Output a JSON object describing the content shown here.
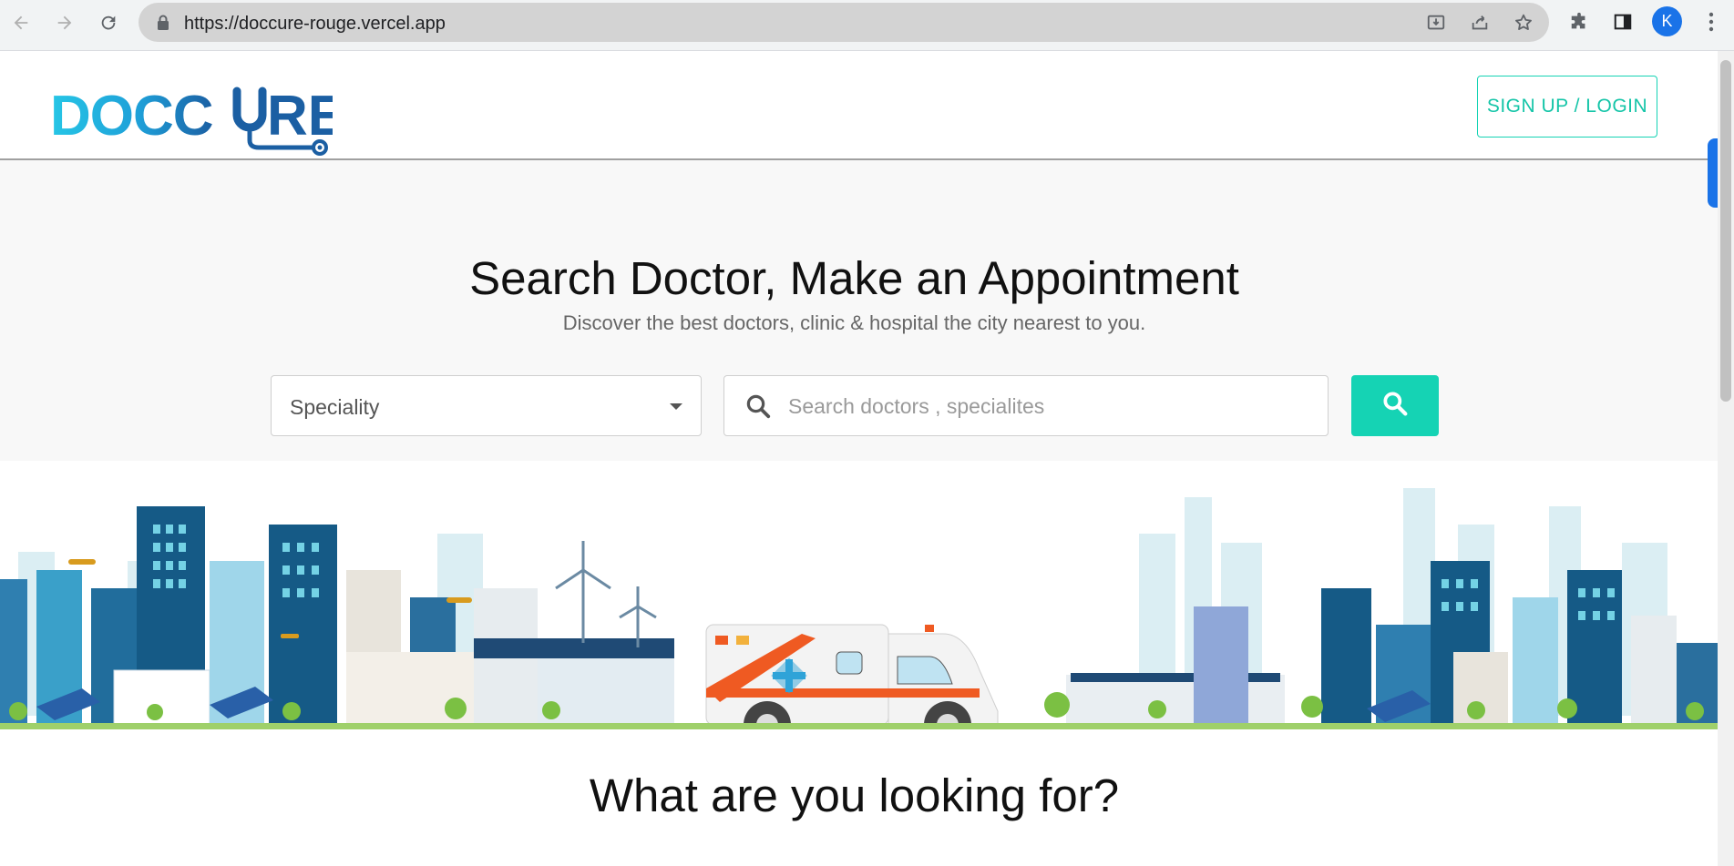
{
  "browser": {
    "url": "https://doccure-rouge.vercel.app",
    "profile_initial": "K",
    "icons": [
      "back-icon",
      "forward-icon",
      "reload-icon",
      "lock-icon",
      "install-icon",
      "share-icon",
      "star-icon",
      "extensions-icon",
      "side-panel-icon",
      "menu-icon"
    ]
  },
  "header": {
    "logo_text": "DOCCURE",
    "login_label": "SIGN UP / LOGIN"
  },
  "hero": {
    "title": "Search Doctor, Make an Appointment",
    "subtitle": "Discover the best doctors, clinic & hospital the city nearest to you.",
    "speciality_label": "Speciality",
    "search_placeholder": "Search doctors , specialites"
  },
  "sections": {
    "looking_for_title": "What are you looking for?"
  },
  "colors": {
    "accent": "#15d3b4",
    "logo_primary": "#1e9fd8",
    "logo_dark": "#1b5fa3",
    "chrome_bg": "#f1f3f4"
  }
}
